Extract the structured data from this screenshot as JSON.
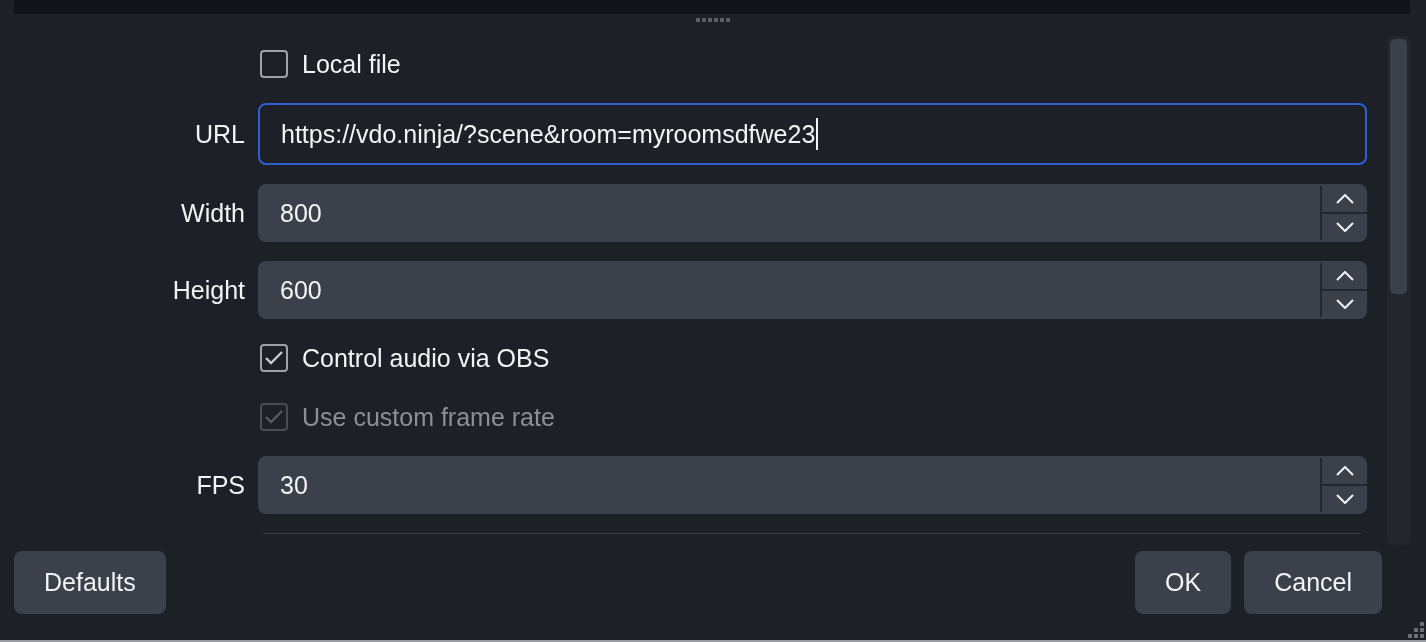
{
  "form": [
    {
      "kind": "checkbox",
      "label": "Local file",
      "checked": false,
      "disabled": false
    },
    {
      "kind": "text",
      "label": "URL",
      "value": "https://vdo.ninja/?scene&room=myroomsdfwe23",
      "focused": true
    },
    {
      "kind": "spin",
      "label": "Width",
      "value": "800"
    },
    {
      "kind": "spin",
      "label": "Height",
      "value": "600"
    },
    {
      "kind": "checkbox",
      "label": "Control audio via OBS",
      "checked": true,
      "disabled": false
    },
    {
      "kind": "checkbox",
      "label": "Use custom frame rate",
      "checked": true,
      "disabled": true
    },
    {
      "kind": "spin",
      "label": "FPS",
      "value": "30"
    }
  ],
  "buttons_left": [
    "Defaults"
  ],
  "buttons_right": [
    "OK",
    "Cancel"
  ]
}
